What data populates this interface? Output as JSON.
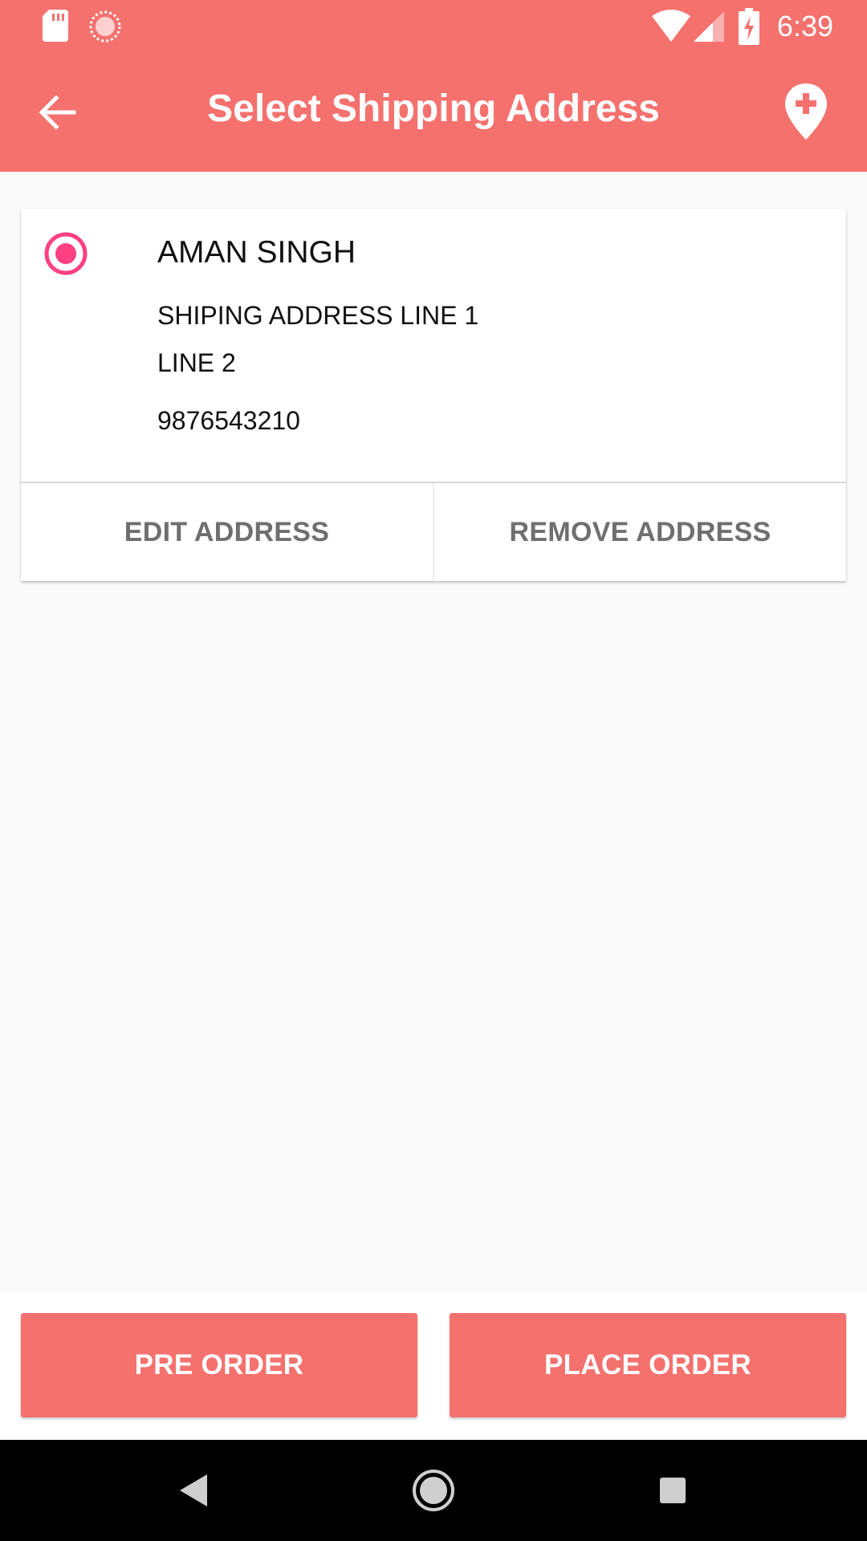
{
  "status_bar": {
    "time": "6:39",
    "icons": [
      "sd-card-icon",
      "sync-icon",
      "wifi-icon",
      "signal-icon",
      "battery-charging-icon"
    ]
  },
  "app_bar": {
    "title": "Select Shipping Address",
    "back_icon": "arrow-back-icon",
    "action_icon": "add-location-icon"
  },
  "address_card": {
    "selected": true,
    "name": "AMAN SINGH",
    "address_line_1": "SHIPING ADDRESS LINE 1",
    "address_line_2": "LINE 2",
    "phone": "9876543210",
    "edit_label": "EDIT ADDRESS",
    "remove_label": "REMOVE ADDRESS"
  },
  "bottom_actions": {
    "pre_order_label": "PRE ORDER",
    "place_order_label": "PLACE ORDER"
  },
  "nav_bar": {
    "icons": [
      "nav-back-icon",
      "nav-home-icon",
      "nav-recents-icon"
    ]
  },
  "colors": {
    "primary": "#f4716e",
    "accent": "#ff4081",
    "background": "#fafafa"
  }
}
